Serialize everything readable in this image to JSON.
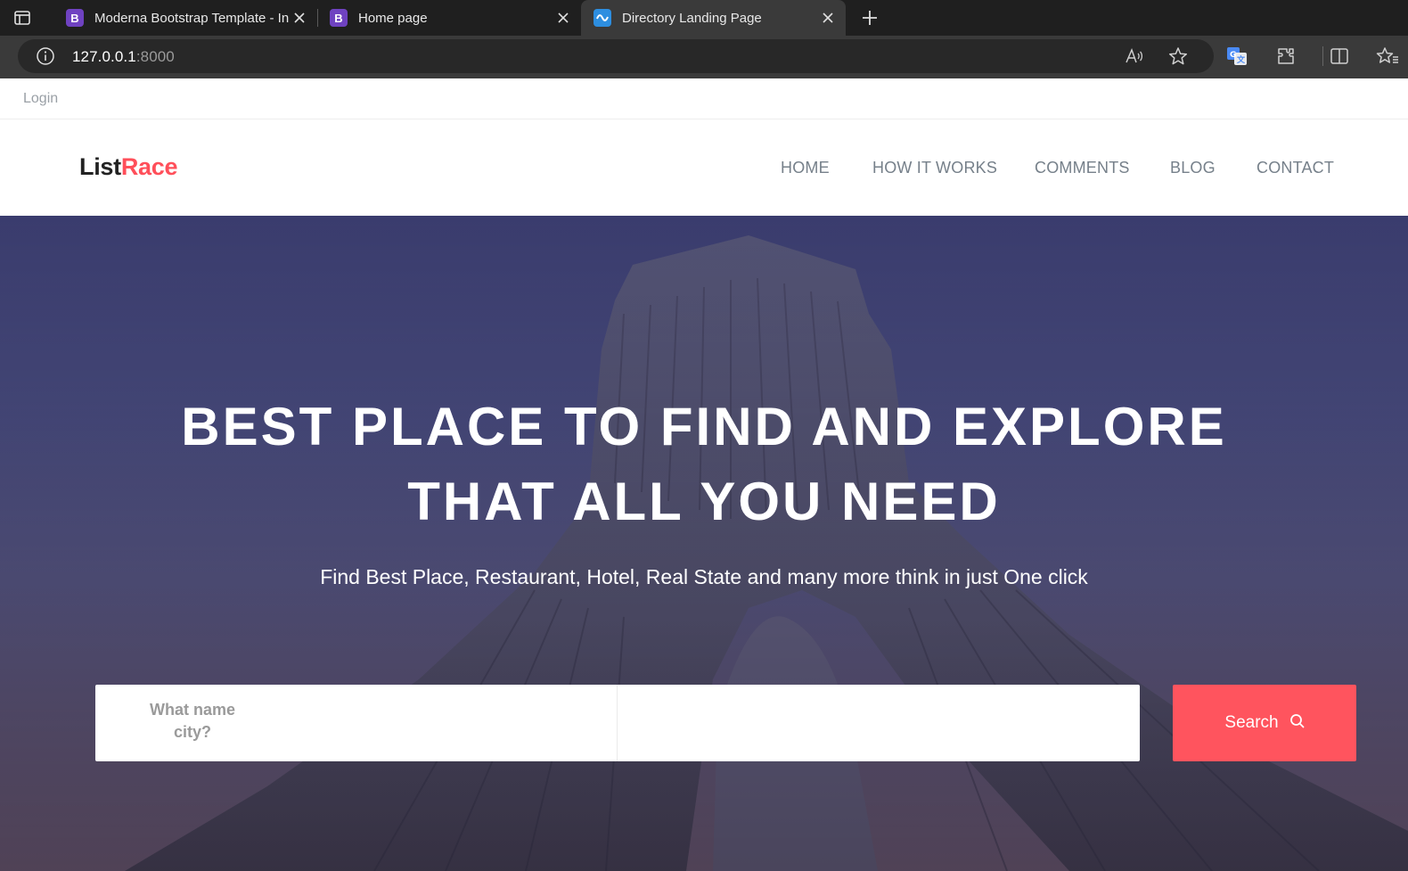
{
  "browser": {
    "tabs": [
      {
        "title": "Moderna Bootstrap Template - In",
        "favicon": "B",
        "active": false
      },
      {
        "title": "Home page",
        "favicon": "B",
        "active": false
      },
      {
        "title": "Directory Landing Page",
        "favicon": "wave",
        "active": true
      }
    ],
    "url_host": "127.0.0.1",
    "url_port": ":8000"
  },
  "topbar": {
    "login": "Login"
  },
  "navbar": {
    "brand_part1": "List",
    "brand_part2": "Race",
    "items": [
      "HOME",
      "HOW IT WORKS",
      "COMMENTS",
      "BLOG",
      "CONTACT"
    ]
  },
  "hero": {
    "title_line1": "BEST PLACE TO FIND AND EXPLORE",
    "title_line2": "THAT ALL YOU NEED",
    "subtitle": "Find Best Place, Restaurant, Hotel, Real State and many more think in just One click",
    "search_label_line1": "What name",
    "search_label_line2": "city?",
    "search_input_value": "",
    "search_button": "Search"
  },
  "colors": {
    "accent": "#ff545e",
    "brand_dark": "#222222",
    "nav_text": "#76808a"
  }
}
